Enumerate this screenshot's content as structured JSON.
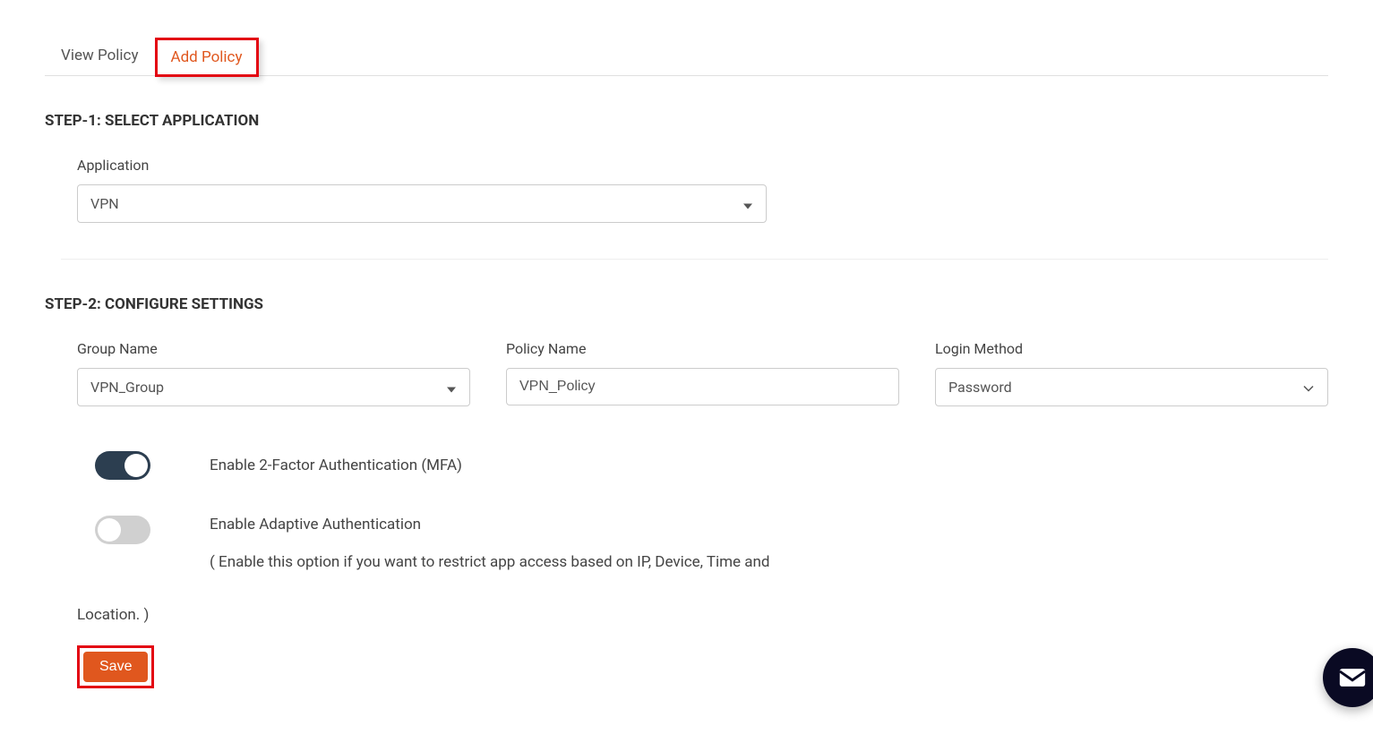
{
  "tabs": {
    "view_policy": "View Policy",
    "add_policy": "Add Policy"
  },
  "step1": {
    "header": "STEP-1: SELECT APPLICATION",
    "application_label": "Application",
    "application_value": "VPN"
  },
  "step2": {
    "header": "STEP-2: CONFIGURE SETTINGS",
    "group_name_label": "Group Name",
    "group_name_value": "VPN_Group",
    "policy_name_label": "Policy Name",
    "policy_name_value": "VPN_Policy",
    "login_method_label": "Login Method",
    "login_method_value": "Password"
  },
  "toggles": {
    "mfa_label": "Enable 2-Factor Authentication (MFA)",
    "adaptive_label": "Enable Adaptive Authentication",
    "adaptive_desc_part1": "( Enable this option if you want to restrict app access based on IP, Device, Time and",
    "adaptive_desc_part2": "Location. )"
  },
  "buttons": {
    "save": "Save"
  }
}
